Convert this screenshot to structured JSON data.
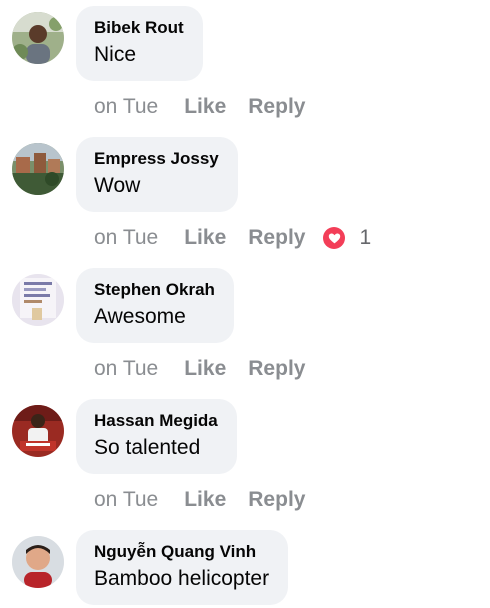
{
  "comments": [
    {
      "author": "Bibek Rout",
      "text": "Nice",
      "time": "on Tue",
      "like_label": "Like",
      "reply_label": "Reply"
    },
    {
      "author": "Empress Jossy",
      "text": "Wow",
      "time": "on Tue",
      "like_label": "Like",
      "reply_label": "Reply",
      "reaction": {
        "icon": "heart-icon",
        "count": "1",
        "color": "#f33e58"
      }
    },
    {
      "author": "Stephen Okrah",
      "text": "Awesome",
      "time": "on Tue",
      "like_label": "Like",
      "reply_label": "Reply"
    },
    {
      "author": "Hassan Megida",
      "text": "So talented",
      "time": "on Tue",
      "like_label": "Like",
      "reply_label": "Reply"
    },
    {
      "author": "Nguyễn Quang Vinh",
      "text": "Bamboo helicopter"
    }
  ],
  "colors": {
    "bubble_bg": "#f0f2f5",
    "meta_text": "#8a8d91",
    "name_text": "#050505"
  }
}
